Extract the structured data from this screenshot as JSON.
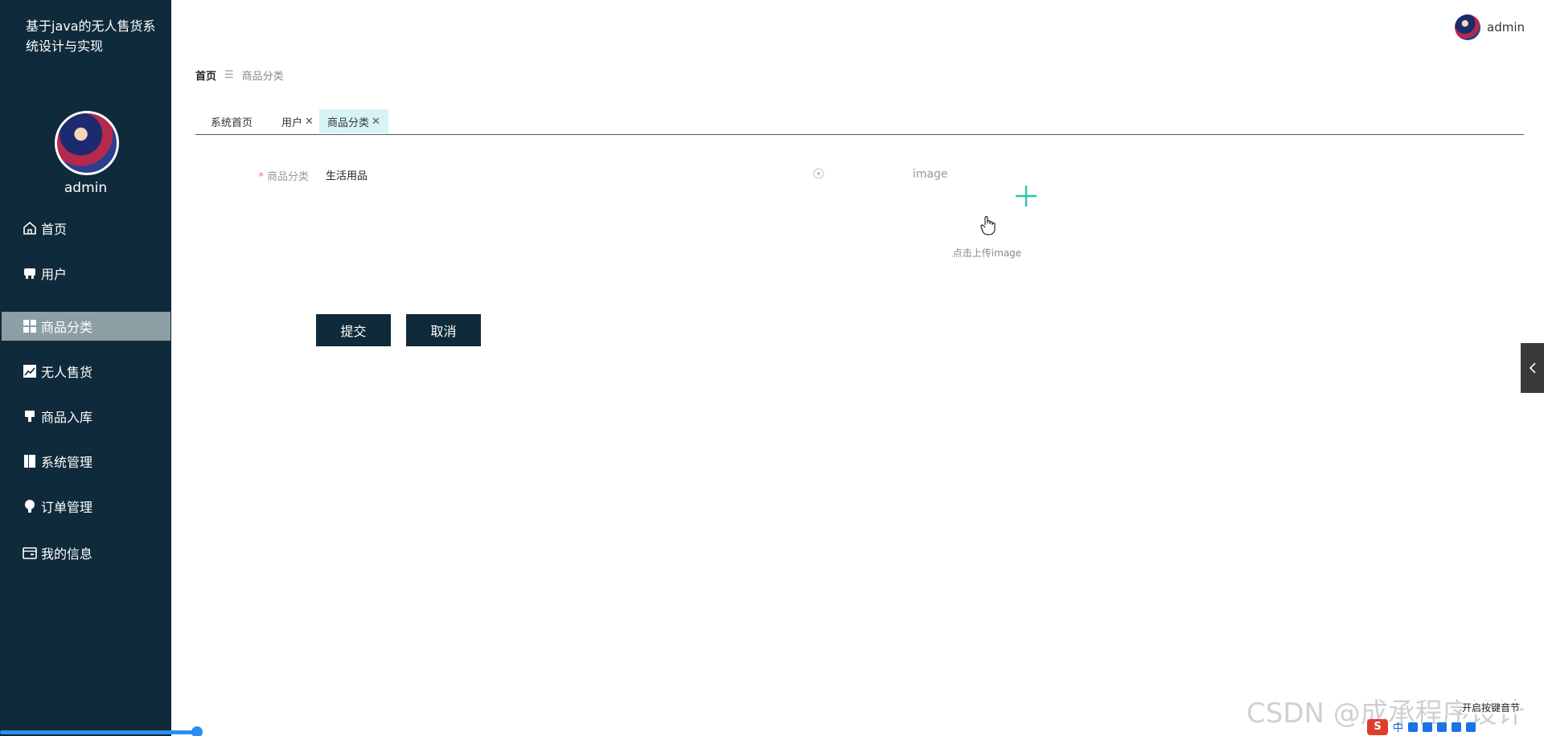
{
  "sidebar": {
    "app_title": "基于java的无人售货系统设计与实现",
    "username": "admin",
    "items": [
      {
        "label": "首页",
        "icon": "home-icon"
      },
      {
        "label": "用户",
        "icon": "user-icon"
      },
      {
        "label": "商品分类",
        "icon": "grid-icon",
        "active": true
      },
      {
        "label": "无人售货",
        "icon": "chart-icon"
      },
      {
        "label": "商品入库",
        "icon": "stamp-icon"
      },
      {
        "label": "系统管理",
        "icon": "book-icon"
      },
      {
        "label": "订单管理",
        "icon": "bulb-icon"
      },
      {
        "label": "我的信息",
        "icon": "card-icon"
      }
    ]
  },
  "header": {
    "username": "admin"
  },
  "breadcrumb": {
    "home": "首页",
    "separator": "☰",
    "current": "商品分类"
  },
  "tabs": [
    {
      "label": "系统首页",
      "closable": false
    },
    {
      "label": "用户",
      "closable": true
    },
    {
      "label": "商品分类",
      "closable": true,
      "active": true
    }
  ],
  "form": {
    "category_label": "商品分类",
    "required_mark": "*",
    "category_value": "生活用品",
    "image_label": "image",
    "upload_tip": "点击上传image",
    "submit_label": "提交",
    "cancel_label": "取消"
  },
  "overlay": {
    "watermark": "CSDN @成承程序设计",
    "ime_status": "开启按键音节",
    "tray_s": "S",
    "tray_lang": "中"
  },
  "colors": {
    "sidebar_bg": "#0f2a3b",
    "active_menu_bg": "#8d9ea5",
    "active_tab_bg": "#d7f3f6",
    "button_bg": "#0f2a3b",
    "upload_plus": "#2ec4a6"
  }
}
